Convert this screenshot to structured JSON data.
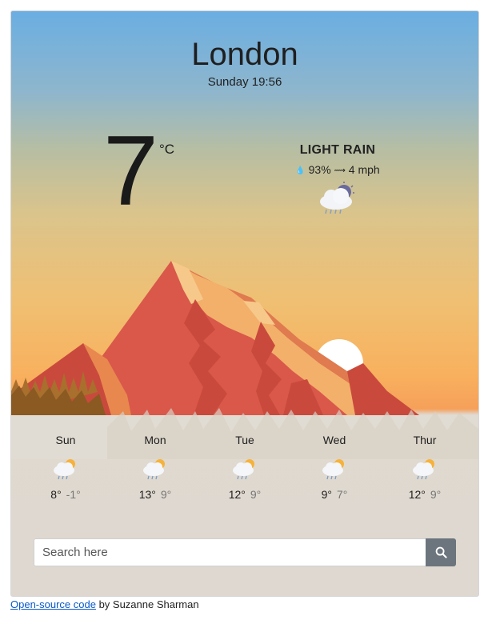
{
  "weather": {
    "city": "London",
    "datetime": "Sunday 19:56",
    "temperature": "7",
    "unit": "°C",
    "description": "LIGHT RAIN",
    "humidity": "93%",
    "wind": "4 mph",
    "icon": "light-rain-icon"
  },
  "forecast": [
    {
      "day": "Sun",
      "max": "8°",
      "min": "-1°",
      "icon": "light-rain-icon"
    },
    {
      "day": "Mon",
      "max": "13°",
      "min": "9°",
      "icon": "light-rain-icon"
    },
    {
      "day": "Tue",
      "max": "12°",
      "min": "9°",
      "icon": "light-rain-icon"
    },
    {
      "day": "Wed",
      "max": "9°",
      "min": "7°",
      "icon": "light-rain-icon"
    },
    {
      "day": "Thur",
      "max": "12°",
      "min": "9°",
      "icon": "light-rain-icon"
    }
  ],
  "search": {
    "placeholder": "Search here",
    "icon": "search-icon"
  },
  "footer": {
    "link_text": "Open-source code",
    "suffix": " by Suzanne Sharman"
  },
  "colors": {
    "sky": "#6aaee2",
    "sunset": "#f8b15e",
    "mountain": "#d9584a",
    "button": "#6c757d",
    "link": "#0a58ca"
  }
}
